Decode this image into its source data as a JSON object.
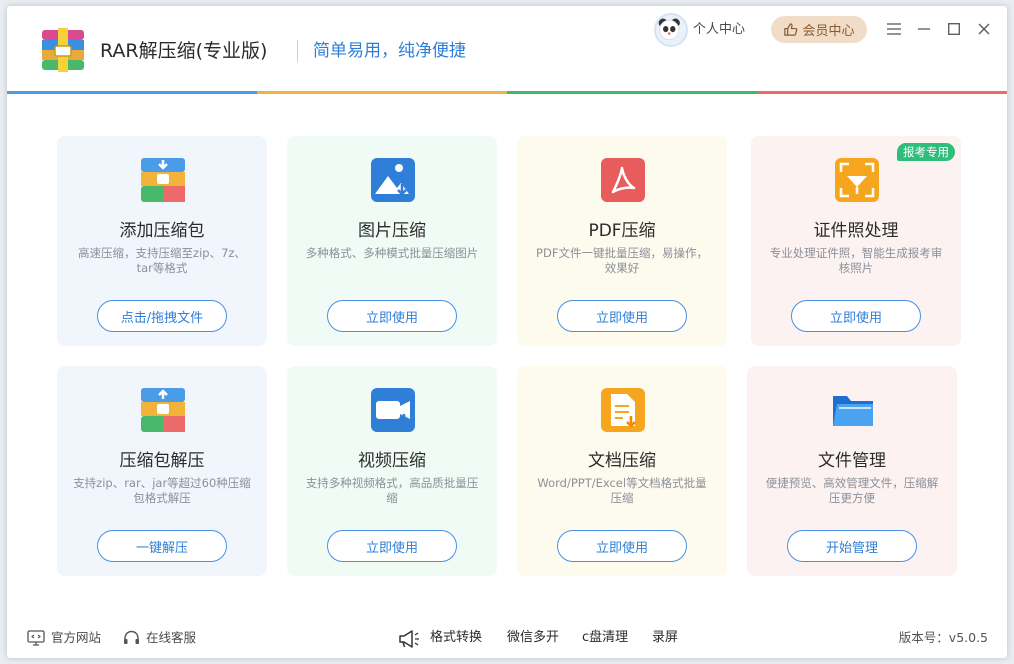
{
  "header": {
    "app_title": "RAR解压缩(专业版)",
    "slogan": "简单易用，纯净便捷",
    "user_center": "个人中心",
    "vip_center": "会员中心"
  },
  "colors": {
    "accent": "#2f7fd8",
    "accent_bar": [
      "#4a9be8",
      "#f2b33a",
      "#3dbb6a",
      "#ec6a6a"
    ],
    "badge": "#2ebd7a"
  },
  "cards": [
    {
      "title": "添加压缩包",
      "desc": "高速压缩，支持压缩至zip、7z、tar等格式",
      "button": "点击/拖拽文件",
      "icon": "archive-add-icon"
    },
    {
      "title": "图片压缩",
      "desc": "多种格式、多种模式批量压缩图片",
      "button": "立即使用",
      "icon": "image-compress-icon"
    },
    {
      "title": "PDF压缩",
      "desc": "PDF文件一键批量压缩，易操作，效果好",
      "button": "立即使用",
      "icon": "pdf-icon"
    },
    {
      "title": "证件照处理",
      "desc": "专业处理证件照，智能生成报考审核照片",
      "button": "立即使用",
      "icon": "id-photo-icon",
      "badge": "报考专用"
    },
    {
      "title": "压缩包解压",
      "desc": "支持zip、rar、jar等超过60种压缩包格式解压",
      "button": "一键解压",
      "icon": "archive-extract-icon"
    },
    {
      "title": "视频压缩",
      "desc": "支持多种视频格式，高品质批量压缩",
      "button": "立即使用",
      "icon": "video-compress-icon"
    },
    {
      "title": "文档压缩",
      "desc": "Word/PPT/Excel等文档格式批量压缩",
      "button": "立即使用",
      "icon": "document-compress-icon"
    },
    {
      "title": "文件管理",
      "desc": "便捷预览、高效管理文件，压缩解压更方便",
      "button": "开始管理",
      "icon": "folder-icon"
    }
  ],
  "footer": {
    "official_site": "官方网站",
    "online_service": "在线客服",
    "links": [
      "格式转换",
      "微信多开",
      "c盘清理",
      "录屏"
    ],
    "version": "版本号：v5.0.5"
  }
}
